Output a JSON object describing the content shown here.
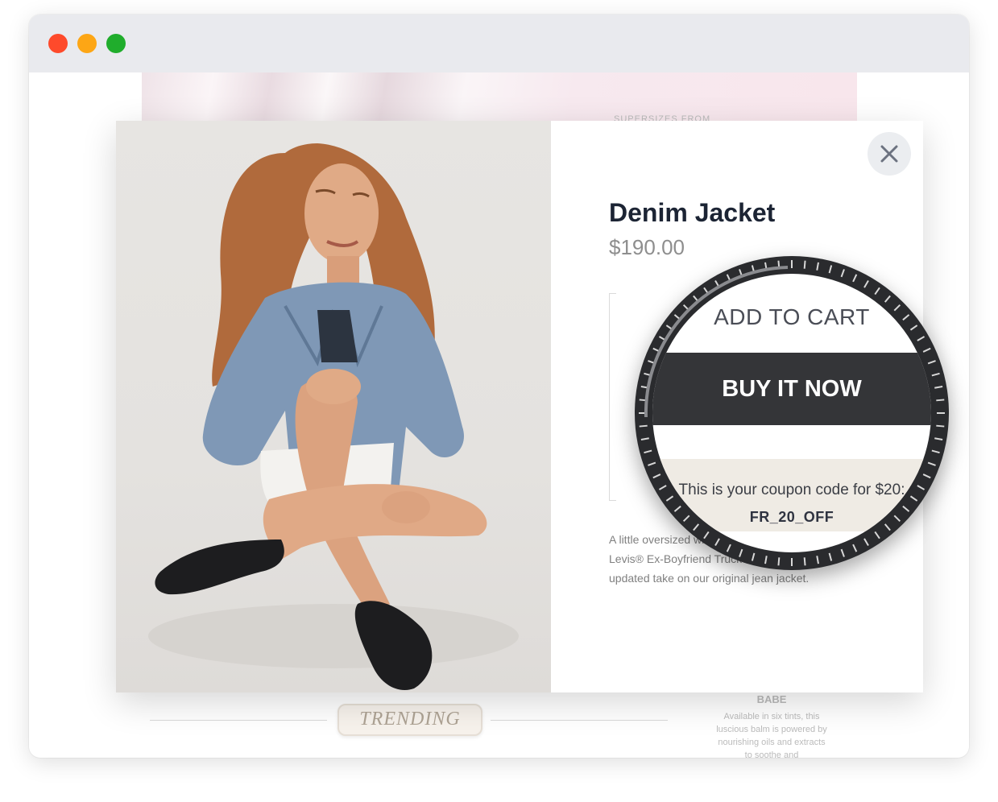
{
  "window": {
    "controls": [
      "close",
      "minimize",
      "maximize"
    ]
  },
  "background_page": {
    "banner_text": "SUPERSIZES FROM",
    "trending_label": "TRENDING",
    "side_product": {
      "title": "BABE",
      "description": "Available in six tints, this luscious balm is powered by nourishing oils and extracts to soothe and"
    }
  },
  "modal": {
    "image_alt": "Model wearing denim jacket",
    "title": "Denim Jacket",
    "price": "$190.00",
    "description": "A little oversized with an extra-relaxed fit, the Levis® Ex-Boyfriend Trucker Jacket is an updated take on our original jean jacket.",
    "close_icon": "close-icon"
  },
  "magnifier": {
    "add_to_cart_label": "ADD TO CART",
    "buy_now_label": "BUY IT NOW",
    "coupon_text": "This is your coupon code for $20:",
    "coupon_code": "FR_20_OFF"
  },
  "colors": {
    "title": "#1c2434",
    "buy_now_bg": "#343538",
    "coupon_bg": "#efebe4",
    "close_red": "#fe4a2b",
    "minimize_yellow": "#fda615",
    "maximize_green": "#20ad2c"
  }
}
